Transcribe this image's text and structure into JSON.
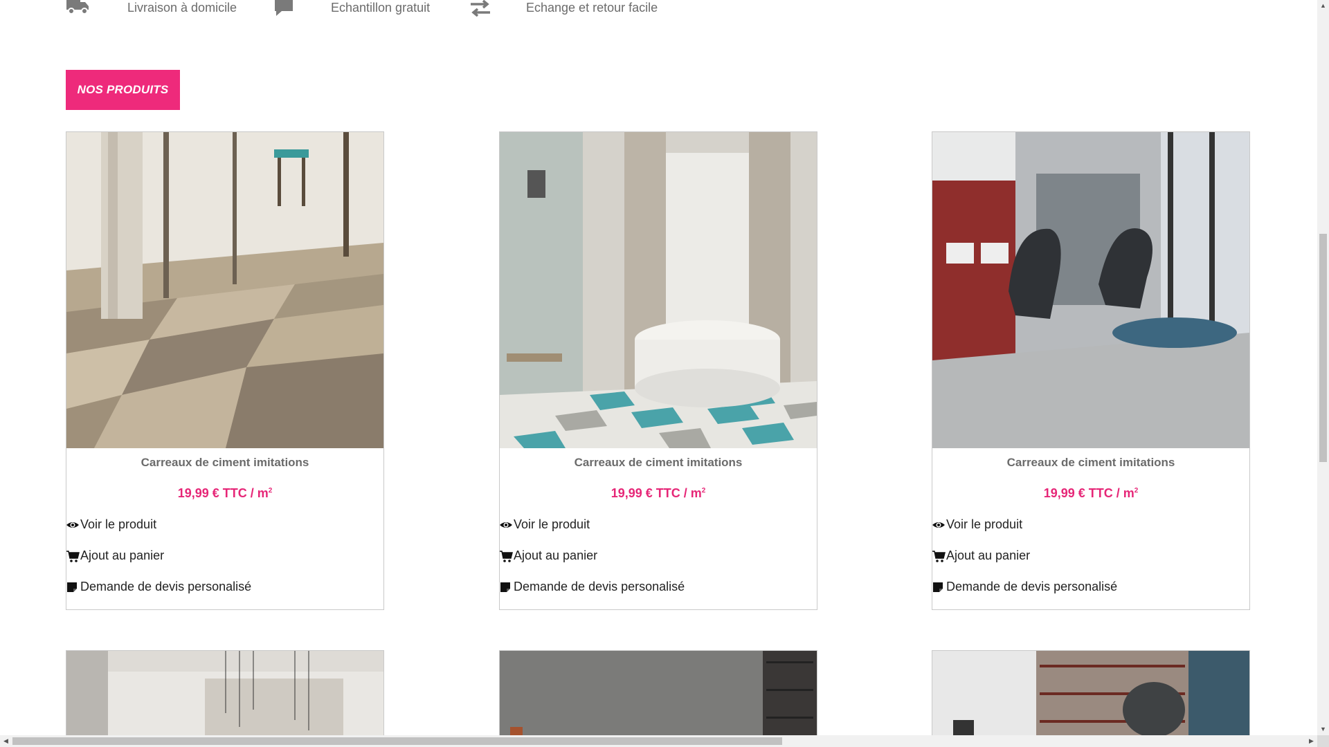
{
  "features": [
    {
      "icon": "truck-icon",
      "label": "Livraison à domicile"
    },
    {
      "icon": "comment-icon",
      "label": "Echantillon gratuit"
    },
    {
      "icon": "exchange-icon",
      "label": "Echange et retour facile"
    }
  ],
  "section": {
    "title": "NOS PRODUITS"
  },
  "brand_color": "#ee2a7b",
  "products": [
    {
      "title": "Carreaux de ciment imitations",
      "price": "19,99 € TTC / m",
      "price_sup": "2",
      "view": "Voir le produit",
      "cart": "Ajout au panier",
      "quote": " Demande de devis personalisé"
    },
    {
      "title": "Carreaux de ciment imitations",
      "price": "19,99 € TTC / m",
      "price_sup": "2",
      "view": "Voir le produit",
      "cart": "Ajout au panier",
      "quote": " Demande de devis personalisé"
    },
    {
      "title": "Carreaux de ciment imitations",
      "price": "19,99 € TTC / m",
      "price_sup": "2",
      "view": "Voir le produit",
      "cart": "Ajout au panier",
      "quote": " Demande de devis personalisé"
    }
  ]
}
